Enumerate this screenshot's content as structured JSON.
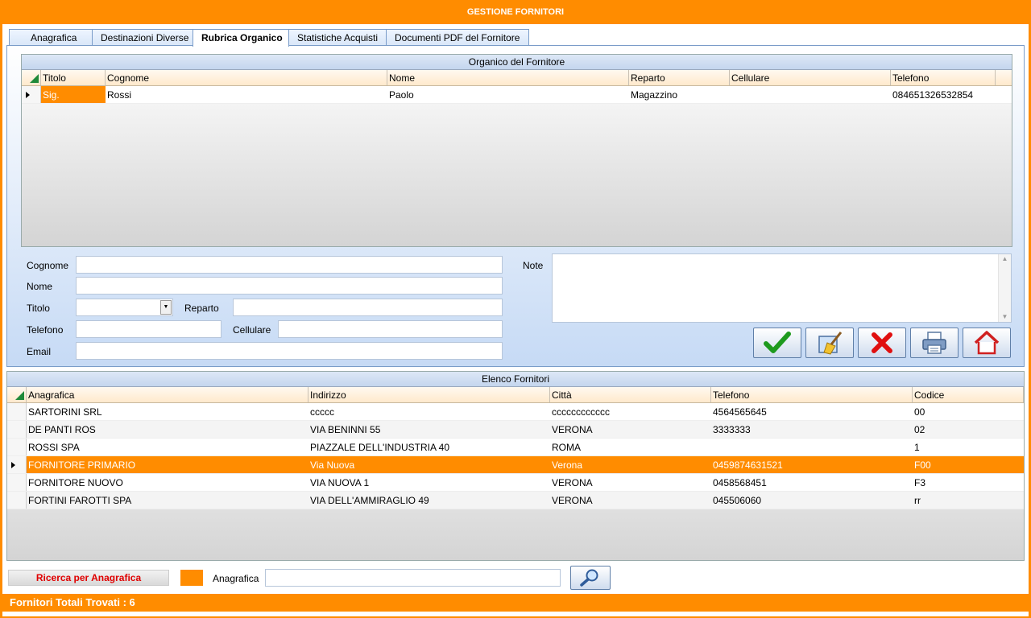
{
  "window": {
    "title": "GESTIONE FORNITORI"
  },
  "tabs": [
    {
      "label": "Anagrafica"
    },
    {
      "label": "Destinazioni Diverse"
    },
    {
      "label": "Rubrica Organico"
    },
    {
      "label": "Statistiche Acquisti"
    },
    {
      "label": "Documenti PDF del Fornitore"
    }
  ],
  "organico": {
    "caption": "Organico del Fornitore",
    "columns": [
      "Titolo",
      "Cognome",
      "Nome",
      "Reparto",
      "Cellulare",
      "Telefono"
    ],
    "rows": [
      [
        "Sig.",
        "Rossi",
        "Paolo",
        "Magazzino",
        "",
        "084651326532854"
      ]
    ]
  },
  "form": {
    "cognome_label": "Cognome",
    "nome_label": "Nome",
    "titolo_label": "Titolo",
    "reparto_label": "Reparto",
    "telefono_label": "Telefono",
    "cellulare_label": "Cellulare",
    "email_label": "Email",
    "note_label": "Note",
    "cognome_value": "",
    "nome_value": "",
    "titolo_value": "",
    "reparto_value": "",
    "telefono_value": "",
    "cellulare_value": "",
    "email_value": "",
    "note_value": ""
  },
  "actions": [
    {
      "icon": "checkmark-icon",
      "color": "#1e9a1e"
    },
    {
      "icon": "broom-icon",
      "color": "#e8b820"
    },
    {
      "icon": "delete-x-icon",
      "color": "#e01010"
    },
    {
      "icon": "printer-icon",
      "color": "#5a78a0"
    },
    {
      "icon": "home-icon",
      "color": "#d02020"
    }
  ],
  "fornitori": {
    "caption": "Elenco Fornitori",
    "columns": [
      "Anagrafica",
      "Indirizzo",
      "Città",
      "Telefono",
      "Codice"
    ],
    "rows": [
      [
        "SARTORINI SRL",
        "ccccc",
        "cccccccccccc",
        "4564565645",
        "00"
      ],
      [
        "DE PANTI ROS",
        "VIA BENINNI 55",
        "VERONA",
        "3333333",
        "02"
      ],
      [
        "ROSSI SPA",
        "PIAZZALE DELL'INDUSTRIA 40",
        "ROMA",
        "",
        "1"
      ],
      [
        "FORNITORE PRIMARIO",
        "Via Nuova",
        "Verona",
        "0459874631521",
        "F00"
      ],
      [
        "FORNITORE NUOVO",
        "VIA NUOVA 1",
        "VERONA",
        "0458568451",
        "F3"
      ],
      [
        "FORTINI FAROTTI SPA",
        "VIA DELL'AMMIRAGLIO 49",
        "VERONA",
        "045506060",
        "rr"
      ]
    ],
    "selected_index": 3
  },
  "search": {
    "mode_label": "Ricerca per Anagrafica",
    "field_label": "Anagrafica",
    "value": ""
  },
  "status": {
    "text": "Fornitori Totali Trovati : 6"
  },
  "colors": {
    "accent": "#ff8c00",
    "panel": "#c6daf5"
  }
}
